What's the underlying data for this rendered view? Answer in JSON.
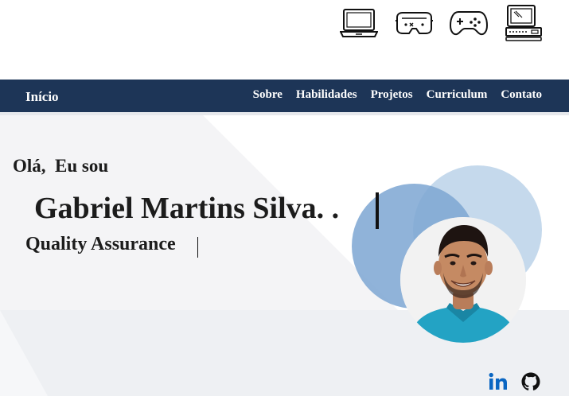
{
  "top_icons": [
    "laptop-icon",
    "vr-headset-icon",
    "gamepad-icon",
    "desktop-computer-icon"
  ],
  "nav": {
    "brand": "Início",
    "links": [
      "Sobre",
      "Habilidades",
      "Projetos",
      "Curriculum",
      "Contato"
    ]
  },
  "hero": {
    "greeting": "Olá,  Eu sou",
    "name": "Gabriel Martins Silva. .",
    "role": "Quality Assurance"
  },
  "social": [
    "linkedin-icon",
    "github-icon"
  ],
  "colors": {
    "navbar": "#1d3557",
    "circle_light": "#c5d9ec",
    "circle_mid": "#7ca6d2",
    "lower_band": "#eef0f3",
    "linkedin": "#0a66c2"
  }
}
